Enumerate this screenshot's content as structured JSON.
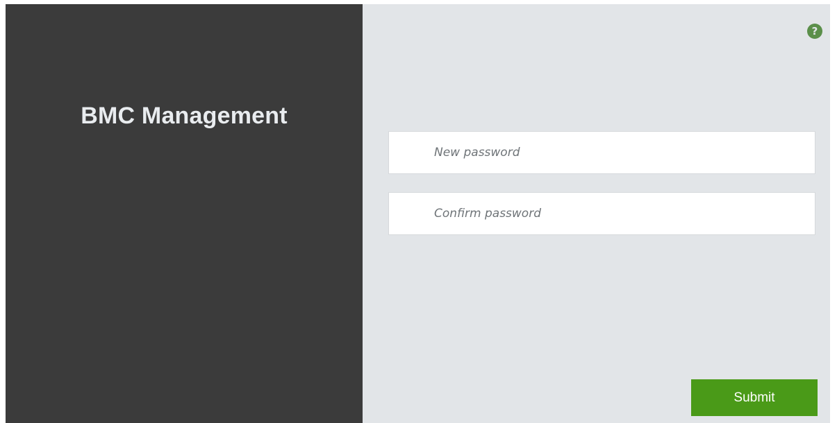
{
  "brand": {
    "title": "BMC Management"
  },
  "help": {
    "icon": "help-icon",
    "glyph": "?"
  },
  "form": {
    "new_password": {
      "value": "",
      "placeholder": "New password"
    },
    "confirm_password": {
      "value": "",
      "placeholder": "Confirm password"
    },
    "submit_label": "Submit"
  },
  "colors": {
    "left_panel": "#3b3b3b",
    "right_panel": "#e2e5e8",
    "accent_green": "#4a9a18",
    "help_icon": "#5b8f4a"
  }
}
